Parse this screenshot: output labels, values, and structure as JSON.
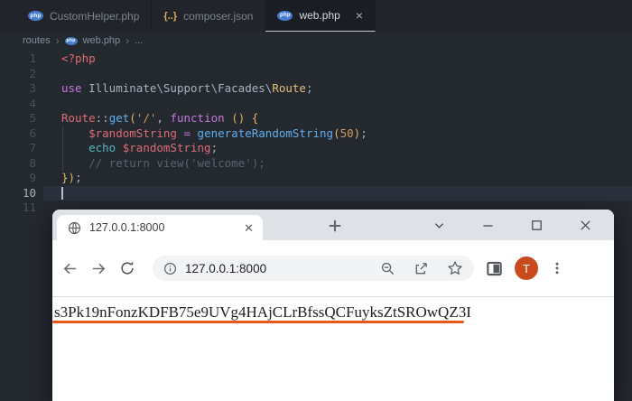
{
  "editor": {
    "tabs": [
      {
        "icon": "php",
        "label": "CustomHelper.php",
        "active": false
      },
      {
        "icon": "json",
        "label": "composer.json",
        "active": false
      },
      {
        "icon": "php",
        "label": "web.php",
        "active": true,
        "close": "×"
      }
    ],
    "icons": {
      "php_badge": "php",
      "json_badge": "{..}"
    },
    "breadcrumb": {
      "root": "routes",
      "file": "web.php",
      "tail": "...",
      "sep": "›"
    },
    "code": {
      "lines": [
        {
          "n": "1",
          "tokens": [
            {
              "t": "<?php",
              "c": "red"
            }
          ]
        },
        {
          "n": "2",
          "tokens": []
        },
        {
          "n": "3",
          "tokens": [
            {
              "t": "use ",
              "c": "purple"
            },
            {
              "t": "Illuminate\\Support\\Facades\\",
              "c": "fg"
            },
            {
              "t": "Route",
              "c": "yellow"
            },
            {
              "t": ";",
              "c": "fg"
            }
          ]
        },
        {
          "n": "4",
          "tokens": []
        },
        {
          "n": "5",
          "tokens": [
            {
              "t": "Route",
              "c": "red"
            },
            {
              "t": "::",
              "c": "fg"
            },
            {
              "t": "get",
              "c": "blue"
            },
            {
              "t": "(",
              "c": "gold"
            },
            {
              "t": "'/'",
              "c": "orange"
            },
            {
              "t": ", ",
              "c": "fg"
            },
            {
              "t": "function ",
              "c": "purple"
            },
            {
              "t": "()",
              "c": "gold"
            },
            {
              "t": " ",
              "c": "fg"
            },
            {
              "t": "{",
              "c": "gold"
            }
          ]
        },
        {
          "n": "6",
          "indent": 1,
          "tokens": [
            {
              "t": "    ",
              "c": "fg"
            },
            {
              "t": "$randomString",
              "c": "red"
            },
            {
              "t": " ",
              "c": "fg"
            },
            {
              "t": "=",
              "c": "purple"
            },
            {
              "t": " ",
              "c": "fg"
            },
            {
              "t": "generateRandomString",
              "c": "blue"
            },
            {
              "t": "(",
              "c": "gold"
            },
            {
              "t": "50",
              "c": "orange"
            },
            {
              "t": ")",
              "c": "gold"
            },
            {
              "t": ";",
              "c": "fg"
            }
          ]
        },
        {
          "n": "7",
          "indent": 1,
          "tokens": [
            {
              "t": "    ",
              "c": "fg"
            },
            {
              "t": "echo ",
              "c": "cyan"
            },
            {
              "t": "$randomString",
              "c": "red"
            },
            {
              "t": ";",
              "c": "fg"
            }
          ]
        },
        {
          "n": "8",
          "indent": 1,
          "tokens": [
            {
              "t": "    ",
              "c": "fg"
            },
            {
              "t": "// return view('welcome');",
              "c": "comment"
            }
          ]
        },
        {
          "n": "9",
          "tokens": [
            {
              "t": "})",
              "c": "gold"
            },
            {
              "t": ";",
              "c": "fg"
            }
          ]
        },
        {
          "n": "10",
          "current": true,
          "tokens": []
        },
        {
          "n": "11",
          "tokens": []
        }
      ]
    }
  },
  "browser": {
    "tab": {
      "title": "127.0.0.1:8000",
      "close": "✕"
    },
    "window_controls": [
      "chevron-down",
      "minimize",
      "maximize",
      "close"
    ],
    "address": {
      "url": "127.0.0.1:8000"
    },
    "avatar": {
      "letter": "T",
      "color": "#cb4a1d"
    },
    "page": {
      "output": "s3Pk19nFonzKDFB75e9UVg4HAjCLrBfssQCFuyksZtSROwQZ3I",
      "underline_color": "#e8581c"
    }
  }
}
